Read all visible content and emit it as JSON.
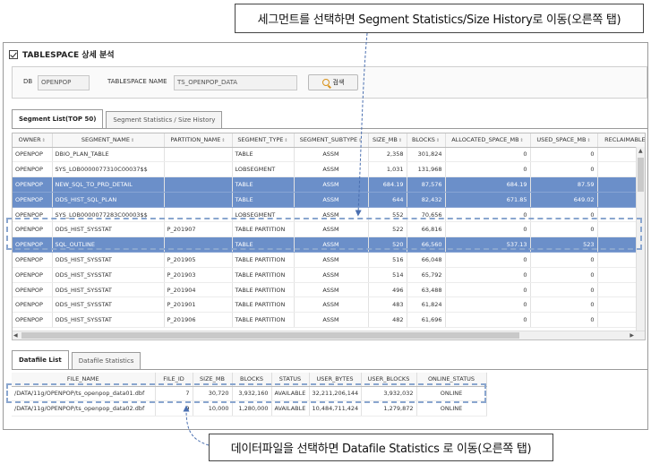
{
  "callouts": {
    "top": "세그먼트를 선택하면 Segment Statistics/Size History로 이동(오른쪽 탭)",
    "bottom": "데이터파일을 선택하면 Datafile Statistics 로 이동(오른쪽 탭)"
  },
  "panel": {
    "title": "TABLESPACE 상세 분석"
  },
  "filter": {
    "db_label": "DB",
    "db_value": "OPENPOP",
    "ts_label": "TABLESPACE NAME",
    "ts_value": "TS_OPENPOP_DATA",
    "search_label": "검색"
  },
  "segment_tabs": [
    "Segment List(TOP 50)",
    "Segment Statistics / Size History"
  ],
  "segment_grid": {
    "columns": [
      "OWNER",
      "SEGMENT_NAME",
      "PARTITION_NAME",
      "SEGMENT_TYPE",
      "SEGMENT_SUBTYPE",
      "SIZE_MB",
      "BLOCKS",
      "ALLOCATED_SPACE_MB",
      "USED_SPACE_MB",
      "RECLAIMABLE"
    ],
    "rows": [
      [
        "OPENPOP",
        "DBIO_PLAN_TABLE",
        "",
        "TABLE",
        "ASSM",
        "2,358",
        "301,824",
        "0",
        "0",
        ""
      ],
      [
        "OPENPOP",
        "SYS_LOB0000077310C00037$$",
        "",
        "LOBSEGMENT",
        "ASSM",
        "1,031",
        "131,968",
        "0",
        "0",
        ""
      ],
      [
        "OPENPOP",
        "NEW_SQL_TO_PRD_DETAIL",
        "",
        "TABLE",
        "ASSM",
        "684.19",
        "87,576",
        "684.19",
        "87.59",
        ""
      ],
      [
        "OPENPOP",
        "ODS_HIST_SQL_PLAN",
        "",
        "TABLE",
        "ASSM",
        "644",
        "82,432",
        "671.85",
        "649.02",
        ""
      ],
      [
        "OPENPOP",
        "SYS_LOB0000077283C00003$$",
        "",
        "LOBSEGMENT",
        "ASSM",
        "552",
        "70,656",
        "0",
        "0",
        ""
      ],
      [
        "OPENPOP",
        "ODS_HIST_SYSSTAT",
        "P_201907",
        "TABLE PARTITION",
        "ASSM",
        "522",
        "66,816",
        "0",
        "0",
        ""
      ],
      [
        "OPENPOP",
        "SQL_OUTLINE",
        "",
        "TABLE",
        "ASSM",
        "520",
        "66,560",
        "537.13",
        "523",
        ""
      ],
      [
        "OPENPOP",
        "ODS_HIST_SYSSTAT",
        "P_201905",
        "TABLE PARTITION",
        "ASSM",
        "516",
        "66,048",
        "0",
        "0",
        ""
      ],
      [
        "OPENPOP",
        "ODS_HIST_SYSSTAT",
        "P_201903",
        "TABLE PARTITION",
        "ASSM",
        "514",
        "65,792",
        "0",
        "0",
        ""
      ],
      [
        "OPENPOP",
        "ODS_HIST_SYSSTAT",
        "P_201904",
        "TABLE PARTITION",
        "ASSM",
        "496",
        "63,488",
        "0",
        "0",
        ""
      ],
      [
        "OPENPOP",
        "ODS_HIST_SYSSTAT",
        "P_201901",
        "TABLE PARTITION",
        "ASSM",
        "483",
        "61,824",
        "0",
        "0",
        ""
      ],
      [
        "OPENPOP",
        "ODS_HIST_SYSSTAT",
        "P_201906",
        "TABLE PARTITION",
        "ASSM",
        "482",
        "61,696",
        "0",
        "0",
        ""
      ]
    ],
    "selected_rows": [
      2,
      3,
      6
    ]
  },
  "datafile_tabs": [
    "Datafile List",
    "Datafile Statistics"
  ],
  "datafile_grid": {
    "columns": [
      "FILE_NAME",
      "FILE_ID",
      "SIZE_MB",
      "BLOCKS",
      "STATUS",
      "USER_BYTES",
      "USER_BLOCKS",
      "ONLINE_STATUS"
    ],
    "rows": [
      [
        "/DATA/11g/OPENPOP/ts_openpop_data01.dbf",
        "7",
        "30,720",
        "3,932,160",
        "AVAILABLE",
        "32,211,206,144",
        "3,932,032",
        "ONLINE"
      ],
      [
        "/DATA/11g/OPENPOP/ts_openpop_data02.dbf",
        "9",
        "10,000",
        "1,280,000",
        "AVAILABLE",
        "10,484,711,424",
        "1,279,872",
        "ONLINE"
      ]
    ]
  },
  "colors": {
    "selected_row": "#6b8fc9",
    "dashed_highlight": "#8aa6cf",
    "arrow": "#4a6fb0"
  }
}
